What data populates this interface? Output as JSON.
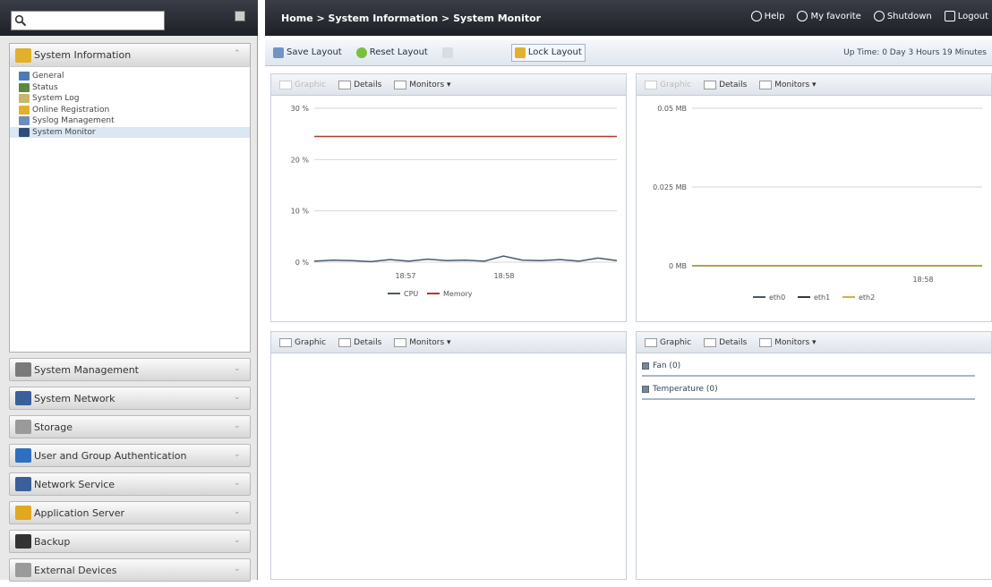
{
  "search": {
    "placeholder": ""
  },
  "tree": {
    "header": "System Information",
    "items": [
      {
        "label": "General",
        "color": "#4a7bb7",
        "selected": false
      },
      {
        "label": "Status",
        "color": "#5b8a3a",
        "selected": false
      },
      {
        "label": "System Log",
        "color": "#c9b56b",
        "selected": false
      },
      {
        "label": "Online Registration",
        "color": "#e2b02b",
        "selected": false
      },
      {
        "label": "Syslog Management",
        "color": "#6d8fb8",
        "selected": false
      },
      {
        "label": "System Monitor",
        "color": "#2f4d7a",
        "selected": true
      }
    ]
  },
  "groups": [
    {
      "label": "System Management",
      "color": "#7a7a7a",
      "icon": "wrench-icon"
    },
    {
      "label": "System Network",
      "color": "#3b5f9a",
      "icon": "network-icon"
    },
    {
      "label": "Storage",
      "color": "#9a9a9a",
      "icon": "storage-icon"
    },
    {
      "label": "User and Group Authentication",
      "color": "#2f6fbf",
      "icon": "users-icon"
    },
    {
      "label": "Network Service",
      "color": "#3b5f9a",
      "icon": "network-service-icon"
    },
    {
      "label": "Application Server",
      "color": "#e2a81f",
      "icon": "application-icon"
    },
    {
      "label": "Backup",
      "color": "#333333",
      "icon": "backup-icon"
    },
    {
      "label": "External Devices",
      "color": "#9a9a9a",
      "icon": "external-devices-icon"
    }
  ],
  "topbar": {
    "breadcrumb": "Home > System Information > System Monitor",
    "help": "Help",
    "favorite": "My favorite",
    "shutdown": "Shutdown",
    "logout": "Logout"
  },
  "toolbar": {
    "save_layout": "Save Layout",
    "reset_layout": "Reset Layout",
    "disabled_item": "",
    "lock_layout": "Lock Layout",
    "clock": "Up Time: 0 Day 3 Hours 19 Minutes"
  },
  "panel_tabs": {
    "graphic": "Graphic",
    "details": "Details",
    "monitors": "Monitors ▾"
  },
  "hardware": {
    "fan": "Fan (0)",
    "temperature": "Temperature (0)"
  },
  "accent": "#2f4d7a",
  "chart_data": [
    {
      "type": "line",
      "ylim": [
        0,
        30
      ],
      "yticks": [
        "30 %",
        "20 %",
        "10 %",
        "0 %"
      ],
      "xticks": [
        "18:57",
        "18:58"
      ],
      "series": [
        {
          "name": "CPU",
          "color": "#4a5a6a",
          "values": [
            0.2,
            0.4,
            0.3,
            0.1,
            0.5,
            0.2,
            0.6,
            0.3,
            0.4,
            0.2,
            1.2,
            0.4,
            0.3,
            0.5,
            0.2,
            0.8,
            0.3
          ]
        },
        {
          "name": "Memory",
          "color": "#b03a2e",
          "values": [
            24.5,
            24.5,
            24.5,
            24.5,
            24.5,
            24.5,
            24.5,
            24.5,
            24.5,
            24.5,
            24.5,
            24.5,
            24.5,
            24.5,
            24.5,
            24.5,
            24.5
          ]
        }
      ]
    },
    {
      "type": "line",
      "ylim": [
        0,
        0.05
      ],
      "yticks": [
        "0.05 MB",
        "0.025 MB",
        "0 MB"
      ],
      "xticks": [
        "18:58"
      ],
      "series": [
        {
          "name": "eth0",
          "color": "#4a5a6a",
          "values": [
            0,
            0,
            0,
            0,
            0,
            0,
            0,
            0,
            0,
            0
          ]
        },
        {
          "name": "eth1",
          "color": "#2f3a44",
          "values": [
            0,
            0,
            0,
            0,
            0,
            0,
            0,
            0,
            0,
            0
          ]
        },
        {
          "name": "eth2",
          "color": "#c9b24b",
          "values": [
            0,
            0,
            0,
            0,
            0,
            0,
            0,
            0,
            0,
            0
          ]
        }
      ]
    }
  ]
}
